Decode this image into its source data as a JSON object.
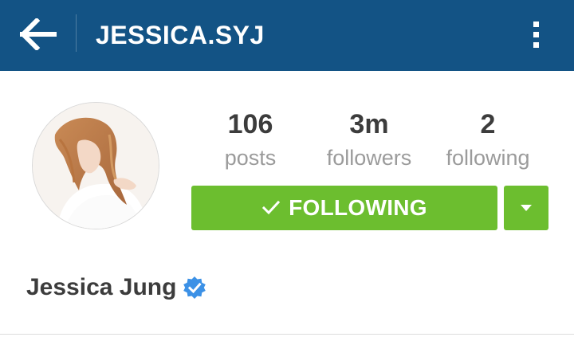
{
  "header": {
    "title": "JESSICA.SYJ",
    "back_icon": "arrow-left-icon",
    "menu_icon": "more-vertical-icon",
    "background_color": "#135385"
  },
  "profile": {
    "name": "Jessica Jung",
    "verified_icon": "verified-badge-icon",
    "avatar": "profile-photo"
  },
  "stats": [
    {
      "value": "106",
      "label": "posts"
    },
    {
      "value": "3m",
      "label": "followers"
    },
    {
      "value": "2",
      "label": "following"
    }
  ],
  "actions": {
    "follow_label": "FOLLOWING",
    "follow_icon": "checkmark-icon",
    "dropdown_icon": "caret-down-icon",
    "button_color": "#6cbe2f"
  }
}
